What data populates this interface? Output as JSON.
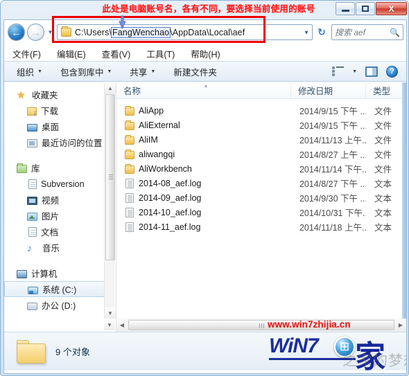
{
  "window": {
    "annotation": "此处是电脑账号名，各有不同，要选择当前使用的账号",
    "controls": {
      "minimize": "最小化",
      "maximize": "最大化",
      "close": "X"
    }
  },
  "navbar": {
    "back_label": "←",
    "forward_label": "→",
    "history_dropdown": "▼",
    "folder_icon": "folder-icon",
    "path_prefix": "C:\\Users\\",
    "path_selected": "FangWenchao",
    "path_suffix": "\\AppData\\Local\\aef",
    "path_full": "C:\\Users\\FangWenchao\\AppData\\Local\\aef",
    "address_dropdown": "▼",
    "refresh_label": "↻",
    "search_placeholder": "搜索 aef",
    "search_icon": "search-icon"
  },
  "menubar": {
    "items": [
      {
        "label": "文件(F)"
      },
      {
        "label": "编辑(E)"
      },
      {
        "label": "查看(V)"
      },
      {
        "label": "工具(T)"
      },
      {
        "label": "帮助(H)"
      }
    ]
  },
  "toolbar": {
    "organize": "组织",
    "include_in_library": "包含到库中",
    "share": "共享",
    "new_folder": "新建文件夹",
    "caret": "▼",
    "view_icon": "view-list-icon",
    "preview_icon": "preview-pane-icon",
    "help_icon": "help-icon",
    "help_glyph": "?"
  },
  "navpane": {
    "favorites": {
      "label": "收藏夹",
      "icon": "star-icon",
      "children": [
        {
          "label": "下载",
          "icon": "download-icon"
        },
        {
          "label": "桌面",
          "icon": "desktop-icon"
        },
        {
          "label": "最近访问的位置",
          "icon": "recent-places-icon"
        }
      ]
    },
    "libraries": {
      "label": "库",
      "icon": "library-icon",
      "children": [
        {
          "label": "Subversion",
          "icon": "document-icon"
        },
        {
          "label": "视频",
          "icon": "video-icon"
        },
        {
          "label": "图片",
          "icon": "picture-icon"
        },
        {
          "label": "文档",
          "icon": "document-icon"
        },
        {
          "label": "音乐",
          "icon": "music-icon"
        }
      ]
    },
    "computer": {
      "label": "计算机",
      "icon": "computer-icon",
      "children": [
        {
          "label": "系统 (C:)",
          "icon": "system-drive-icon",
          "selected": true
        },
        {
          "label": "办公 (D:)",
          "icon": "drive-icon",
          "selected": false
        }
      ]
    }
  },
  "filelist": {
    "columns": [
      {
        "key": "name",
        "label": "名称",
        "sorted": "asc",
        "sort_glyph": "▲"
      },
      {
        "key": "date",
        "label": "修改日期"
      },
      {
        "key": "type",
        "label": "类型"
      }
    ],
    "rows": [
      {
        "name": "AliApp",
        "date": "2014/9/15 下午 ...",
        "type": "文件",
        "icon": "folder-icon"
      },
      {
        "name": "AliExternal",
        "date": "2014/9/15 下午 ...",
        "type": "文件",
        "icon": "folder-icon"
      },
      {
        "name": "AliIM",
        "date": "2014/11/13 上午...",
        "type": "文件",
        "icon": "folder-icon"
      },
      {
        "name": "aliwangqi",
        "date": "2014/8/27 上午 ...",
        "type": "文件",
        "icon": "folder-icon"
      },
      {
        "name": "AliWorkbench",
        "date": "2014/11/14 下午...",
        "type": "文件",
        "icon": "folder-icon"
      },
      {
        "name": "2014-08_aef.log",
        "date": "2014/8/27 下午 ...",
        "type": "文本",
        "icon": "log-file-icon"
      },
      {
        "name": "2014-09_aef.log",
        "date": "2014/9/30 下午 ...",
        "type": "文本",
        "icon": "log-file-icon"
      },
      {
        "name": "2014-10_aef.log",
        "date": "2014/10/31 下午...",
        "type": "文本",
        "icon": "log-file-icon"
      },
      {
        "name": "2014-11_aef.log",
        "date": "2014/11/18 上午...",
        "type": "文本",
        "icon": "log-file-icon"
      }
    ]
  },
  "statusbar": {
    "count_text": "9 个对象",
    "folder_icon": "large-folder-icon"
  },
  "watermark": {
    "url": "www.win7zhijia.cn",
    "logo_text": "WiN7",
    "logo_dot": ".",
    "logo_cjk": "家",
    "logo_ghost": "之家的梦想",
    "orb_glyph": "⊞"
  },
  "colors": {
    "annotation_red": "#ff1a1a",
    "box_red": "#ee0000",
    "watermark_red": "#e31b1b",
    "logo_blue": "#1a2f9e",
    "selection_blue": "#5b7fc7"
  }
}
